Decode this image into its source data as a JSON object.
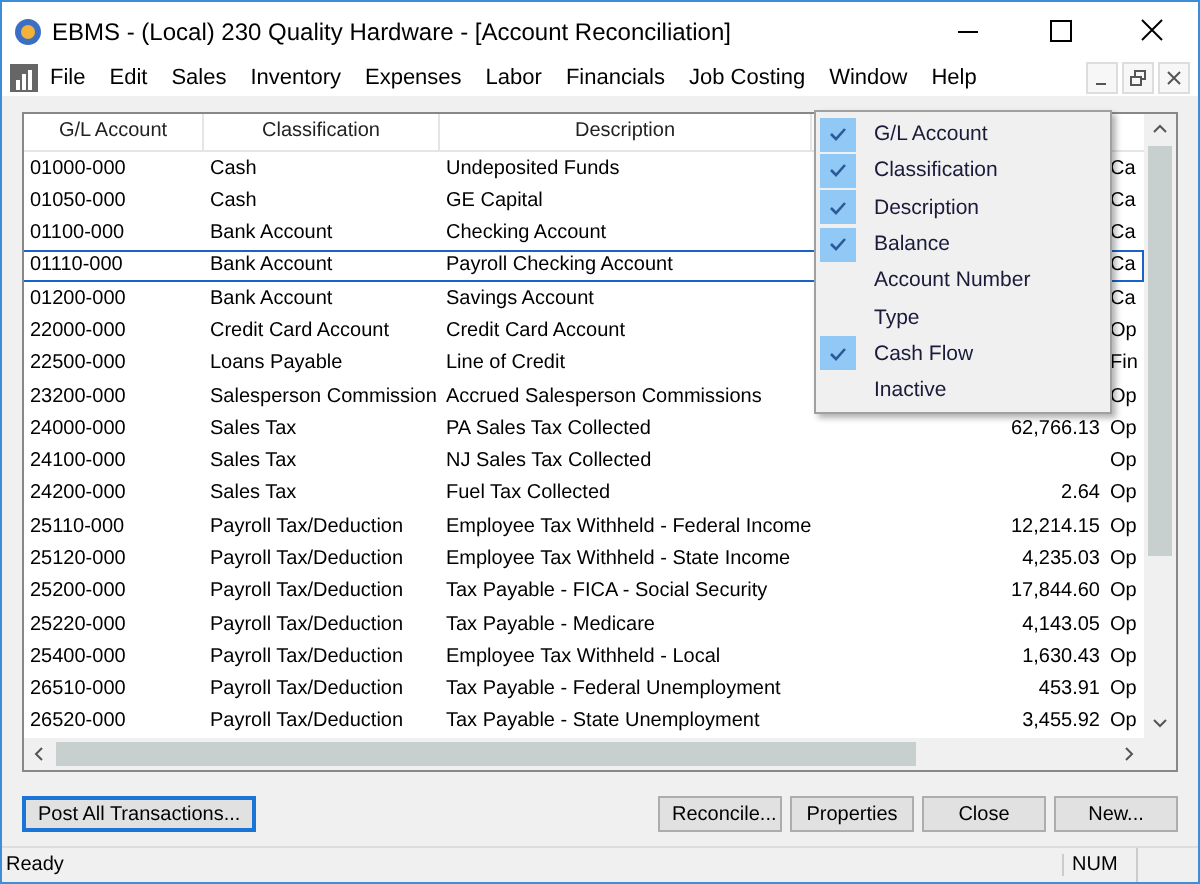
{
  "window": {
    "title": "EBMS - (Local) 230 Quality Hardware - [Account Reconciliation]"
  },
  "menu_bar": [
    "File",
    "Edit",
    "Sales",
    "Inventory",
    "Expenses",
    "Labor",
    "Financials",
    "Job Costing",
    "Window",
    "Help"
  ],
  "table": {
    "columns": [
      "G/L Account",
      "Classification",
      "Description"
    ],
    "rows": [
      {
        "account": "01000-000",
        "classification": "Cash",
        "description": "Undeposited Funds",
        "column_5": "Ca",
        "selected": false
      },
      {
        "account": "01050-000",
        "classification": "Cash",
        "description": "GE Capital",
        "column_5": "Ca",
        "selected": false
      },
      {
        "account": "01100-000",
        "classification": "Bank Account",
        "description": "Checking Account",
        "column_5": "Ca",
        "selected": false
      },
      {
        "account": "01110-000",
        "classification": "Bank Account",
        "description": "Payroll Checking Account",
        "column_5": "Ca",
        "selected": true
      },
      {
        "account": "01200-000",
        "classification": "Bank Account",
        "description": "Savings Account",
        "column_5": "Ca",
        "selected": false
      },
      {
        "account": "22000-000",
        "classification": "Credit Card Account",
        "description": "Credit Card Account",
        "column_5": "Op",
        "selected": false
      },
      {
        "account": "22500-000",
        "classification": "Loans Payable",
        "description": "Line of Credit",
        "column_5": "Fin",
        "selected": false
      },
      {
        "account": "23200-000",
        "classification": "Salesperson Commission",
        "description": "Accrued Salesperson Commissions",
        "column_5": "Op",
        "selected": false
      },
      {
        "account": "24000-000",
        "classification": "Sales Tax",
        "description": "PA Sales Tax Collected",
        "balance": "62,766.13",
        "column_5": "Op",
        "selected": false
      },
      {
        "account": "24100-000",
        "classification": "Sales Tax",
        "description": "NJ Sales Tax Collected",
        "column_5": "Op",
        "selected": false
      },
      {
        "account": "24200-000",
        "classification": "Sales Tax",
        "description": "Fuel Tax Collected",
        "balance": "2.64",
        "column_5": "Op",
        "selected": false
      },
      {
        "account": "25110-000",
        "classification": "Payroll Tax/Deduction",
        "description": "Employee Tax Withheld - Federal Income",
        "balance": "12,214.15",
        "column_5": "Op",
        "selected": false
      },
      {
        "account": "25120-000",
        "classification": "Payroll Tax/Deduction",
        "description": "Employee Tax Withheld - State Income",
        "balance": "4,235.03",
        "column_5": "Op",
        "selected": false
      },
      {
        "account": "25200-000",
        "classification": "Payroll Tax/Deduction",
        "description": "Tax Payable - FICA - Social Security",
        "balance": "17,844.60",
        "column_5": "Op",
        "selected": false
      },
      {
        "account": "25220-000",
        "classification": "Payroll Tax/Deduction",
        "description": "Tax Payable - Medicare",
        "balance": "4,143.05",
        "column_5": "Op",
        "selected": false
      },
      {
        "account": "25400-000",
        "classification": "Payroll Tax/Deduction",
        "description": "Employee Tax Withheld - Local",
        "balance": "1,630.43",
        "column_5": "Op",
        "selected": false
      },
      {
        "account": "26510-000",
        "classification": "Payroll Tax/Deduction",
        "description": "Tax Payable - Federal Unemployment",
        "balance": "453.91",
        "column_5": "Op",
        "selected": false
      },
      {
        "account": "26520-000",
        "classification": "Payroll Tax/Deduction",
        "description": "Tax Payable - State Unemployment",
        "balance": "3,455.92",
        "column_5": "Op",
        "selected": false
      }
    ]
  },
  "column_menu": [
    {
      "label": "G/L Account",
      "checked": true
    },
    {
      "label": "Classification",
      "checked": true
    },
    {
      "label": "Description",
      "checked": true
    },
    {
      "label": "Balance",
      "checked": true
    },
    {
      "label": "Account Number",
      "checked": false
    },
    {
      "label": "Type",
      "checked": false
    },
    {
      "label": "Cash Flow",
      "checked": true
    },
    {
      "label": "Inactive",
      "checked": false
    }
  ],
  "buttons_left": [
    "Post All Transactions..."
  ],
  "buttons_right": [
    "Reconcile...",
    "Properties",
    "Close",
    "New..."
  ],
  "status_bar": {
    "message": "Ready",
    "indicator": "NUM"
  }
}
